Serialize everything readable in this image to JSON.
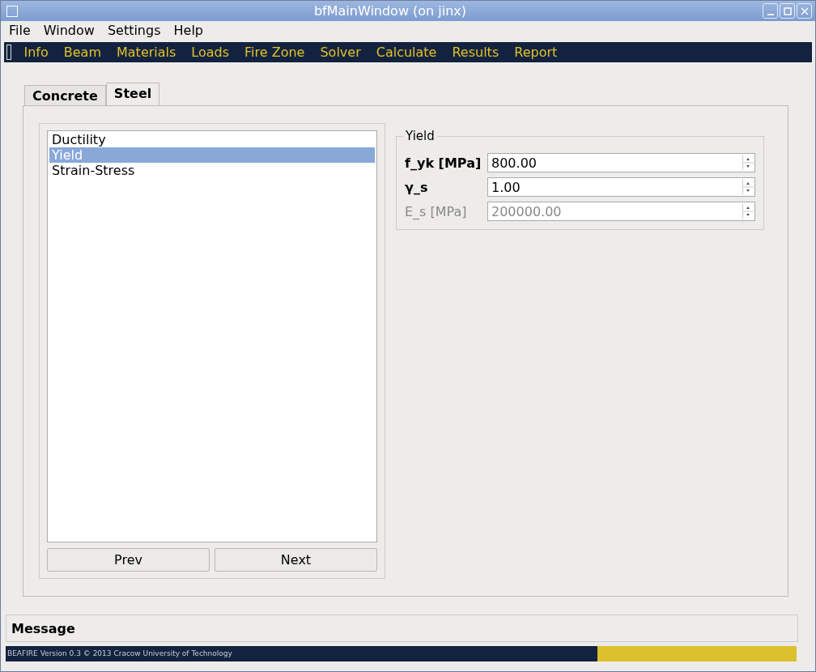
{
  "window": {
    "title": "bfMainWindow (on jinx)"
  },
  "menu": [
    "File",
    "Window",
    "Settings",
    "Help"
  ],
  "toolbar": [
    "Info",
    "Beam",
    "Materials",
    "Loads",
    "Fire Zone",
    "Solver",
    "Calculate",
    "Results",
    "Report"
  ],
  "tabs": [
    {
      "label": "Concrete",
      "selected": false
    },
    {
      "label": "Steel",
      "selected": true
    }
  ],
  "list": [
    {
      "label": "Ductility",
      "selected": false
    },
    {
      "label": "Yield",
      "selected": true
    },
    {
      "label": "Strain-Stress",
      "selected": false
    }
  ],
  "buttons": [
    "Prev",
    "Next"
  ],
  "group": {
    "title": "Yield",
    "fields": [
      {
        "label": "f_yk [MPa]",
        "value": "800.00",
        "disabled": false
      },
      {
        "label": "γ_s",
        "value": "1.00",
        "disabled": false
      },
      {
        "label": "E_s [MPa]",
        "value": "200000.00",
        "disabled": true
      }
    ]
  },
  "message": {
    "label": "Message"
  },
  "status_bar": {
    "text": "BEAFIRE Version 0.3 © 2013 Cracow University of Technology"
  }
}
